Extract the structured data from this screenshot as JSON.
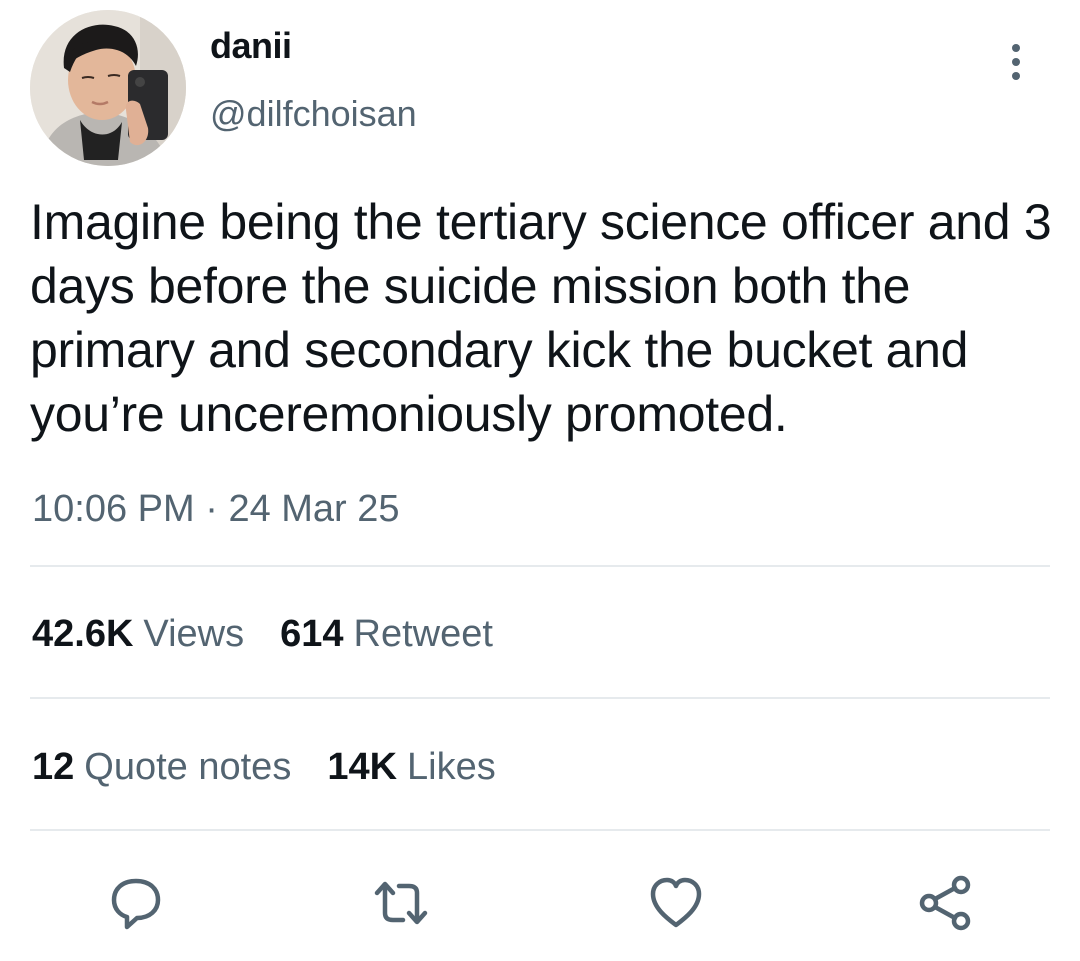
{
  "author": {
    "display_name": "danii",
    "handle": "@dilfchoisan"
  },
  "tweet": {
    "text": "Imagine being the tertiary science officer and 3 days before the suicide mission both the primary and secondary kick the bucket and you’re unceremoniously promoted.",
    "time": "10:06 PM",
    "separator": "·",
    "date": "24 Mar 25"
  },
  "stats": {
    "views": {
      "num": "42.6K",
      "label": "Views"
    },
    "retweets": {
      "num": "614",
      "label": "Retweet"
    },
    "quotes": {
      "num": "12",
      "label": "Quote notes"
    },
    "likes": {
      "num": "14K",
      "label": "Likes"
    }
  },
  "actions": {
    "reply_icon": "reply-icon",
    "retweet_icon": "retweet-icon",
    "like_icon": "heart-icon",
    "share_icon": "share-icon"
  },
  "colors": {
    "text": "#0f1419",
    "secondary": "#536471",
    "divider": "#e6eaed"
  }
}
